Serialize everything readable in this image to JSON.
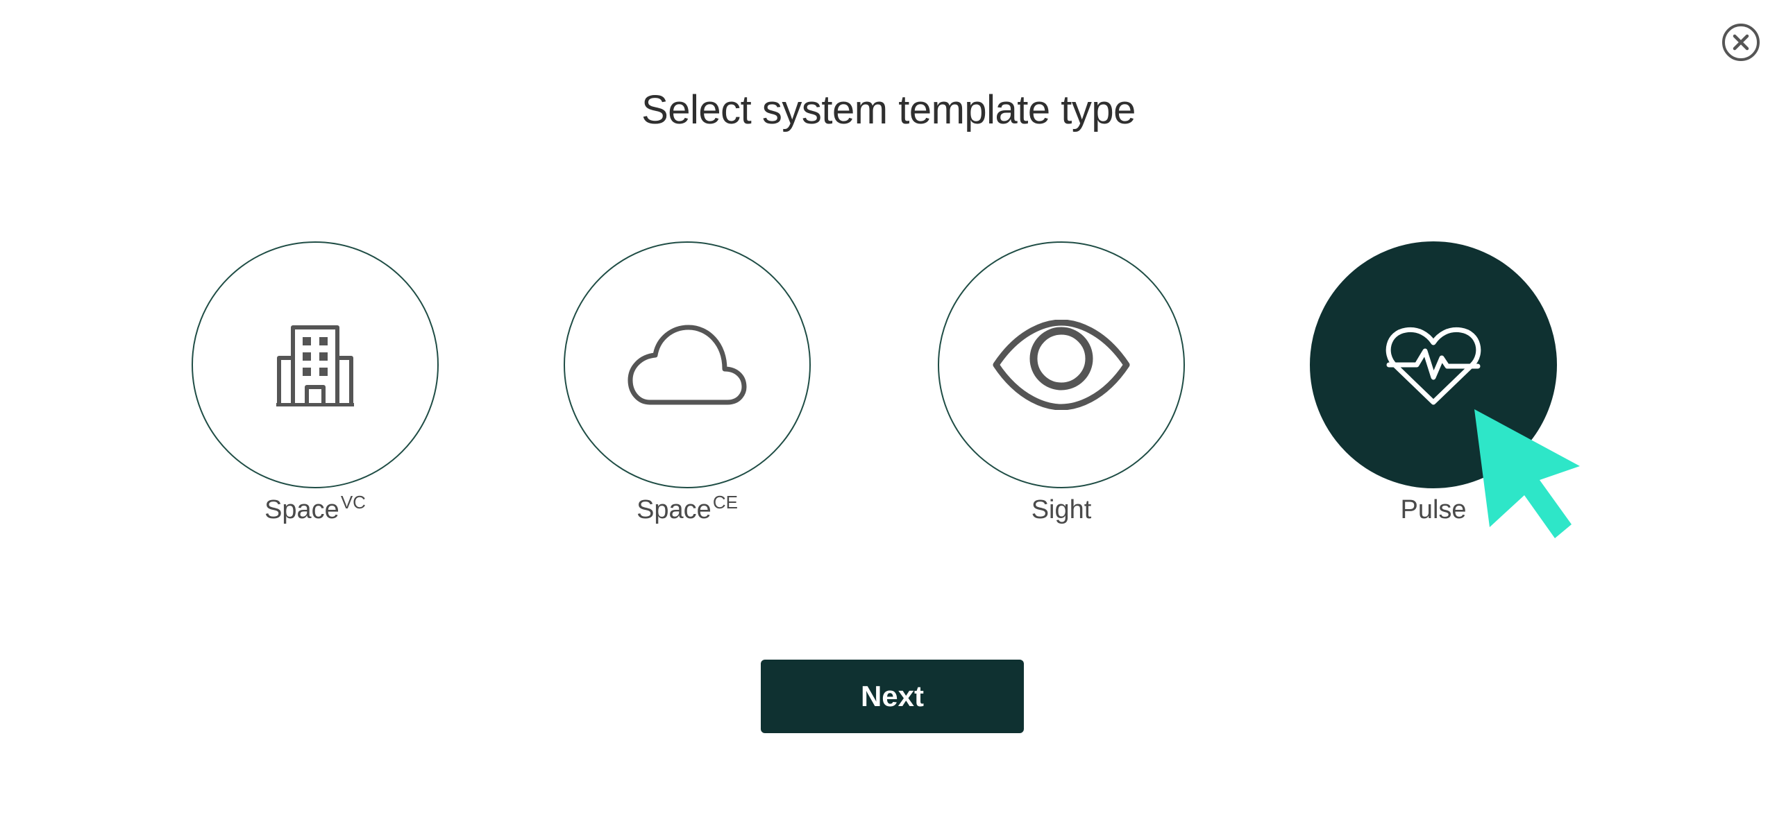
{
  "dialog": {
    "title": "Select system template type",
    "close_icon": "close-circle-icon"
  },
  "options": [
    {
      "label": "Space",
      "superscript": "VC",
      "icon": "building-icon",
      "selected": false
    },
    {
      "label": "Space",
      "superscript": "CE",
      "icon": "cloud-icon",
      "selected": false
    },
    {
      "label": "Sight",
      "superscript": "",
      "icon": "eye-icon",
      "selected": false
    },
    {
      "label": "Pulse",
      "superscript": "",
      "icon": "heart-pulse-icon",
      "selected": true
    }
  ],
  "next_button": {
    "label": "Next"
  },
  "colors": {
    "primary": "#0f3131",
    "circle_border": "#1f4d45",
    "cursor": "#2ee6c8",
    "text": "#2f2f2f"
  }
}
